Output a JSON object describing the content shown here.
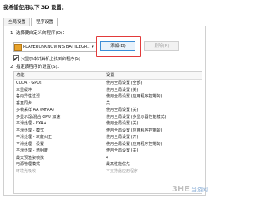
{
  "header": {
    "title": "我希望使用以下 3D 设置："
  },
  "tabs": [
    {
      "label": "全局设置",
      "active": false
    },
    {
      "label": "程序设置",
      "active": true
    }
  ],
  "step1": {
    "label": "1. 选择要自定义的程序(O)：",
    "program_value": "PLAYERUNKNOWN'S BATTLEGR...",
    "add_button": "添加(D)",
    "remove_button": "删除(R)",
    "show_only_checkbox": {
      "label": "只显示本计算机上找到的程序(S)",
      "checked": true
    }
  },
  "step2": {
    "label": "2. 指定该程序的设置(S)：",
    "columns": [
      "功能",
      "设置"
    ],
    "rows": [
      {
        "feature": "CUDA - GPUs",
        "setting": "使用全局设置 (全部)"
      },
      {
        "feature": "三重缓冲",
        "setting": "使用全局设置 (关)"
      },
      {
        "feature": "各向异性过滤",
        "setting": "使用全局设置 (应用程序控制的)"
      },
      {
        "feature": "垂直同步",
        "setting": "关"
      },
      {
        "feature": "多帧采样 AA (MFAA)",
        "setting": "使用全局设置 (关)"
      },
      {
        "feature": "多显示器/混合 GPU 加速",
        "setting": "使用全局设置 (多显示器性能模式)"
      },
      {
        "feature": "平滑处理 - FXAA",
        "setting": "使用全局设置 (关)"
      },
      {
        "feature": "平滑处理 - 模式",
        "setting": "使用全局设置 (应用程序控制的)"
      },
      {
        "feature": "平滑处理 - 灰度纠正",
        "setting": "使用全局设置 (开)"
      },
      {
        "feature": "平滑处理 - 设置",
        "setting": "使用全局设置 (应用程序控制的)"
      },
      {
        "feature": "平滑处理 - 透明度",
        "setting": "使用全局设置 (关)"
      },
      {
        "feature": "最大预渲染帧数",
        "setting": "4"
      },
      {
        "feature": "电源管理模式",
        "setting": "最高性能优先"
      },
      {
        "feature": "环境光吸收",
        "setting": "不支持此应用程序",
        "dim": true
      }
    ]
  },
  "watermark": {
    "logo": "3HE",
    "text": "当游网"
  }
}
